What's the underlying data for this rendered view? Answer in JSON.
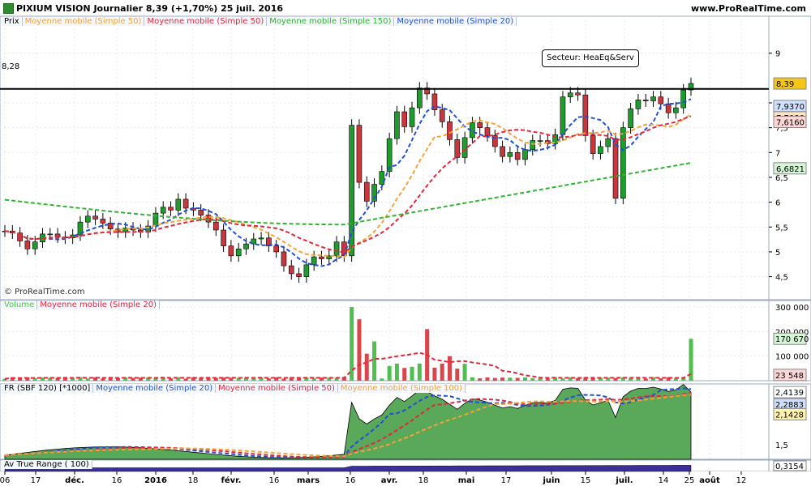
{
  "header": {
    "title": "PIXIUM VISION   Journalier   8,39 (+1,70%)   25 juil. 2016",
    "url": "www.ProRealTime.com",
    "watermark": "© ProRealTime.com"
  },
  "colors": {
    "up": "#1f9d2c",
    "down": "#c8373d",
    "ma20": "#1f4fd8",
    "ma50": "#e0283c",
    "ma100": "#f2a33a",
    "ma150": "#2fb52f",
    "volume_up": "#4fc04f",
    "volume_down": "#d9454d",
    "fr_fill": "#5aa85a",
    "atr_fill": "#3b2fa0",
    "panel_bg": "#eef3fb"
  },
  "panels": {
    "price": {
      "legend": [
        "Prix",
        "Moyenne mobile (Simple 50)",
        "Moyenne mobile (Simple 50)",
        "Moyenne mobile (Simple 150)",
        "Moyenne mobile (Simple 20)"
      ],
      "hline_label": "8,28",
      "annotation": "Secteur: HeaEq&Serv",
      "badges": [
        "8,39",
        "7,9370",
        "7,7080",
        "7,6160",
        "6,6821"
      ]
    },
    "volume": {
      "legend": [
        "Volume",
        "Moyenne mobile (Simple 20)"
      ],
      "badges": [
        "170 670",
        "23 548"
      ]
    },
    "fr": {
      "legend": [
        "FR (SBF 120) [*1000]",
        "Moyenne mobile (Simple 20)",
        "Moyenne mobile (Simple 50)",
        "Moyenne mobile (Simple 100)"
      ],
      "badges": [
        "2,4139",
        "2,2883",
        "2,1428"
      ]
    },
    "atr": {
      "legend": [
        "Av True Range ( 100)"
      ],
      "badge": "0,3154"
    }
  },
  "chart_data": [
    {
      "type": "candlestick",
      "title": "PIXIUM VISION",
      "x_ticks": [
        "06",
        "17",
        "déc.",
        "16",
        "2016",
        "18",
        "févr.",
        "16",
        "mars",
        "16",
        "avr.",
        "18",
        "mai",
        "17",
        "juin",
        "15",
        "juil.",
        "14",
        "25",
        "août",
        "12"
      ],
      "y_ticks": [
        "4,5",
        "5",
        "5,5",
        "6",
        "6,5",
        "7",
        "7,5",
        "8",
        "9"
      ],
      "ylim": [
        4.2,
        9.5
      ],
      "close": [
        5.42,
        5.38,
        5.22,
        5.06,
        5.2,
        5.36,
        5.36,
        5.3,
        5.28,
        5.34,
        5.6,
        5.72,
        5.66,
        5.58,
        5.46,
        5.4,
        5.48,
        5.44,
        5.4,
        5.52,
        5.78,
        5.9,
        5.84,
        6.06,
        5.88,
        5.84,
        5.74,
        5.6,
        5.44,
        5.12,
        4.92,
        5.06,
        5.16,
        5.26,
        5.28,
        5.12,
        5.0,
        4.72,
        4.56,
        4.5,
        4.74,
        4.9,
        4.86,
        4.92,
        5.2,
        4.92,
        7.55,
        6.4,
        6.02,
        6.36,
        6.62,
        7.28,
        7.82,
        7.52,
        7.9,
        8.3,
        8.18,
        7.86,
        7.62,
        7.26,
        6.9,
        7.3,
        7.6,
        7.5,
        7.34,
        7.12,
        6.92,
        7.0,
        6.86,
        7.06,
        7.24,
        7.24,
        7.18,
        7.36,
        8.12,
        8.2,
        8.16,
        7.34,
        6.98,
        7.12,
        7.28,
        6.08,
        7.5,
        7.88,
        8.06,
        8.04,
        8.12,
        7.98,
        7.8,
        7.9,
        8.26,
        8.39
      ],
      "ma20_end": 7.937,
      "ma50_end": 7.616,
      "ma100_end": 7.708,
      "ma150_end": 6.6821,
      "hline": 8.28
    },
    {
      "type": "bar",
      "title": "Volume",
      "y_ticks": [
        "100 000",
        "200 000",
        "300 000"
      ],
      "ylim": [
        0,
        310000
      ],
      "last_value": 170670,
      "ma20_last": 23548
    },
    {
      "type": "area",
      "title": "FR (SBF 120) [*1000]",
      "y_ticks": [
        "1,5",
        "2",
        "2,4139"
      ],
      "ylim": [
        1.25,
        2.5
      ],
      "last_value": 2.4139,
      "ma20_last": 2.2883,
      "ma50_last": 2.2883,
      "ma100_last": 2.1428
    },
    {
      "type": "area",
      "title": "Av True Range ( 100)",
      "last_value": 0.3154
    }
  ]
}
